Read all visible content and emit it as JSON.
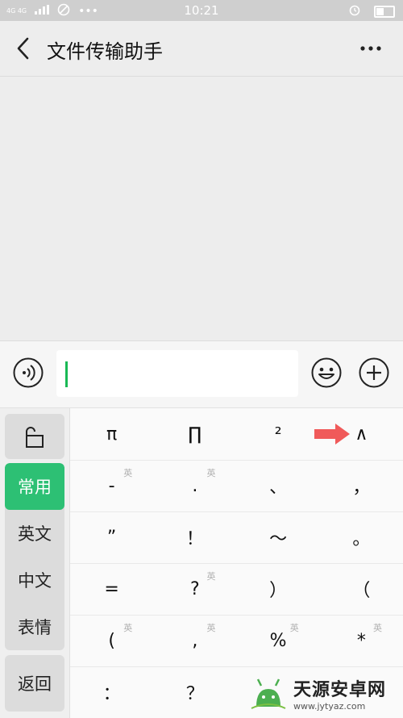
{
  "status_bar": {
    "time": "10:21",
    "network": "4G 4G"
  },
  "header": {
    "title": "文件传输助手"
  },
  "input_bar": {
    "value": ""
  },
  "keyboard": {
    "categories": [
      {
        "label": "常用",
        "active": true
      },
      {
        "label": "英文",
        "active": false
      },
      {
        "label": "中文",
        "active": false
      },
      {
        "label": "表情",
        "active": false
      }
    ],
    "back_label": "返回",
    "rows": [
      [
        {
          "char": "π",
          "badge": ""
        },
        {
          "char": "∏",
          "badge": ""
        },
        {
          "char": "²",
          "badge": ""
        },
        {
          "char": "∧",
          "badge": ""
        }
      ],
      [
        {
          "char": "-",
          "badge": "英"
        },
        {
          "char": ".",
          "badge": "英"
        },
        {
          "char": "、",
          "badge": ""
        },
        {
          "char": "，",
          "badge": ""
        }
      ],
      [
        {
          "char": "”",
          "badge": ""
        },
        {
          "char": "！",
          "badge": ""
        },
        {
          "char": "～",
          "badge": ""
        },
        {
          "char": "。",
          "badge": ""
        }
      ],
      [
        {
          "char": "=",
          "badge": ""
        },
        {
          "char": "?",
          "badge": "英"
        },
        {
          "char": "）",
          "badge": ""
        },
        {
          "char": "（",
          "badge": ""
        }
      ],
      [
        {
          "char": "(",
          "badge": "英"
        },
        {
          "char": ",",
          "badge": "英"
        },
        {
          "char": "%",
          "badge": "英"
        },
        {
          "char": "*",
          "badge": "英"
        }
      ],
      [
        {
          "char": "：",
          "badge": ""
        },
        {
          "char": "？",
          "badge": ""
        },
        {
          "char": "",
          "badge": ""
        },
        {
          "char": "",
          "badge": ""
        }
      ]
    ]
  },
  "watermark": {
    "title": "天源安卓网",
    "url": "www.jytyaz.com"
  },
  "colors": {
    "accent_green": "#2dc074",
    "caret_green": "#19b955",
    "arrow_red": "#f05a5a"
  }
}
